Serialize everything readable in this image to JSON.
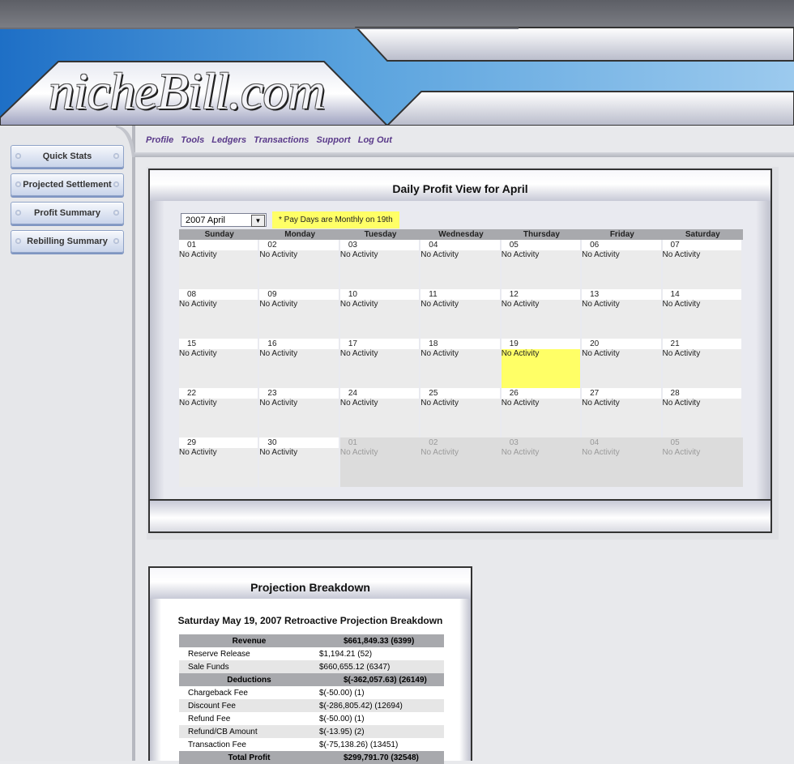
{
  "brand": {
    "logo_text": "nicheBill.com"
  },
  "sidebar": {
    "items": [
      {
        "label": "Quick Stats"
      },
      {
        "label": "Projected Settlement"
      },
      {
        "label": "Profit Summary"
      },
      {
        "label": "Rebilling Summary"
      }
    ]
  },
  "nav": {
    "items": [
      {
        "label": "Profile"
      },
      {
        "label": "Tools"
      },
      {
        "label": "Ledgers"
      },
      {
        "label": "Transactions"
      },
      {
        "label": "Support"
      },
      {
        "label": "Log Out"
      }
    ]
  },
  "calendar_panel": {
    "title": "Daily Profit View for April",
    "month_select": {
      "value": "2007 April"
    },
    "payday_note": "* Pay Days are Monthly on 19th",
    "weekdays": [
      "Sunday",
      "Monday",
      "Tuesday",
      "Wednesday",
      "Thursday",
      "Friday",
      "Saturday"
    ],
    "weeks": [
      [
        {
          "day": "01",
          "text": "No Activity"
        },
        {
          "day": "02",
          "text": "No Activity"
        },
        {
          "day": "03",
          "text": "No Activity"
        },
        {
          "day": "04",
          "text": "No Activity"
        },
        {
          "day": "05",
          "text": "No Activity"
        },
        {
          "day": "06",
          "text": "No Activity"
        },
        {
          "day": "07",
          "text": "No Activity"
        }
      ],
      [
        {
          "day": "08",
          "text": "No Activity"
        },
        {
          "day": "09",
          "text": "No Activity"
        },
        {
          "day": "10",
          "text": "No Activity"
        },
        {
          "day": "11",
          "text": "No Activity"
        },
        {
          "day": "12",
          "text": "No Activity"
        },
        {
          "day": "13",
          "text": "No Activity"
        },
        {
          "day": "14",
          "text": "No Activity"
        }
      ],
      [
        {
          "day": "15",
          "text": "No Activity"
        },
        {
          "day": "16",
          "text": "No Activity"
        },
        {
          "day": "17",
          "text": "No Activity"
        },
        {
          "day": "18",
          "text": "No Activity"
        },
        {
          "day": "19",
          "text": "No Activity",
          "highlight": true
        },
        {
          "day": "20",
          "text": "No Activity"
        },
        {
          "day": "21",
          "text": "No Activity"
        }
      ],
      [
        {
          "day": "22",
          "text": "No Activity"
        },
        {
          "day": "23",
          "text": "No Activity"
        },
        {
          "day": "24",
          "text": "No Activity"
        },
        {
          "day": "25",
          "text": "No Activity"
        },
        {
          "day": "26",
          "text": "No Activity"
        },
        {
          "day": "27",
          "text": "No Activity"
        },
        {
          "day": "28",
          "text": "No Activity"
        }
      ],
      [
        {
          "day": "29",
          "text": "No Activity"
        },
        {
          "day": "30",
          "text": "No Activity"
        },
        {
          "day": "01",
          "text": "No Activity",
          "other_month": true
        },
        {
          "day": "02",
          "text": "No Activity",
          "other_month": true
        },
        {
          "day": "03",
          "text": "No Activity",
          "other_month": true
        },
        {
          "day": "04",
          "text": "No Activity",
          "other_month": true
        },
        {
          "day": "05",
          "text": "No Activity",
          "other_month": true
        }
      ]
    ]
  },
  "projection_panel": {
    "title": "Projection Breakdown",
    "subtitle": "Saturday May 19, 2007 Retroactive Projection Breakdown",
    "rows": [
      {
        "type": "section",
        "label": "Revenue",
        "value": "$661,849.33 (6399)"
      },
      {
        "type": "row",
        "label": "Reserve Release",
        "value": "$1,194.21 (52)"
      },
      {
        "type": "row",
        "label": "Sale Funds",
        "value": "$660,655.12 (6347)"
      },
      {
        "type": "section",
        "label": "Deductions",
        "value": "$(-362,057.63) (26149)"
      },
      {
        "type": "row",
        "label": "Chargeback Fee",
        "value": "$(-50.00) (1)"
      },
      {
        "type": "row",
        "label": "Discount Fee",
        "value": "$(-286,805.42) (12694)"
      },
      {
        "type": "row",
        "label": "Refund Fee",
        "value": "$(-50.00) (1)"
      },
      {
        "type": "row",
        "label": "Refund/CB Amount",
        "value": "$(-13.95) (2)"
      },
      {
        "type": "row",
        "label": "Transaction Fee",
        "value": "$(-75,138.26) (13451)"
      },
      {
        "type": "section",
        "label": "Total Profit",
        "value": "$299,791.70 (32548)"
      }
    ]
  },
  "colors": {
    "highlight": "#ffff66",
    "header_blue": "#3a88d2",
    "nav_text": "#5a3a8a"
  }
}
